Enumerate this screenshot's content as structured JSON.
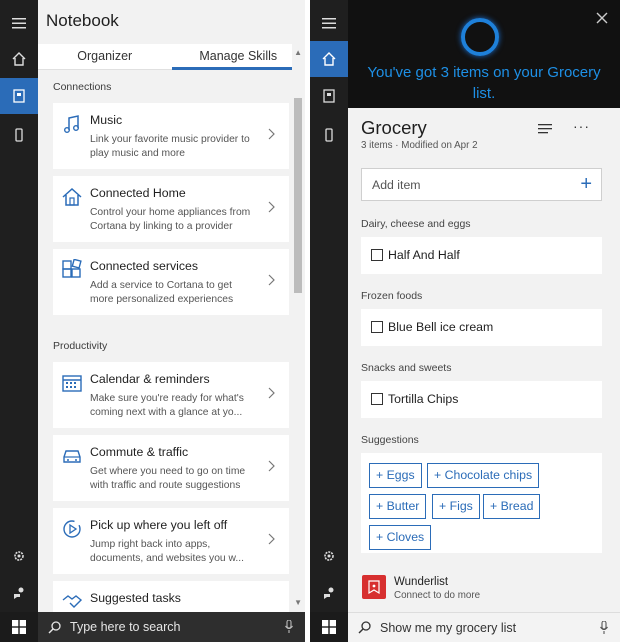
{
  "notebook": {
    "title": "Notebook",
    "tabs": [
      "Organizer",
      "Manage Skills"
    ],
    "sections": {
      "connections": "Connections",
      "productivity": "Productivity"
    },
    "cards": [
      {
        "title": "Music",
        "desc": "Link your favorite music provider to play music and more",
        "icon": "music-icon"
      },
      {
        "title": "Connected Home",
        "desc": "Control your home appliances from Cortana by linking to a provider",
        "icon": "home-icon"
      },
      {
        "title": "Connected services",
        "desc": "Add a service to Cortana to get more personalized experiences",
        "icon": "services-icon"
      },
      {
        "title": "Calendar & reminders",
        "desc": "Make sure you're ready for what's coming next with a glance at yo...",
        "icon": "calendar-icon"
      },
      {
        "title": "Commute & traffic",
        "desc": "Get where you need to go on time with traffic and route suggestions",
        "icon": "car-icon"
      },
      {
        "title": "Pick up where you left off",
        "desc": "Jump right back into apps, documents, and websites you w...",
        "icon": "resume-icon"
      },
      {
        "title": "Suggested tasks",
        "desc": "",
        "icon": "handshake-icon"
      }
    ],
    "search_placeholder": "Type here to search"
  },
  "cortana": {
    "message": "You've got 3 items on your Grocery list.",
    "list_title": "Grocery",
    "list_subtitle": "3 items · Modified on Apr 2",
    "add_placeholder": "Add item",
    "categories": [
      {
        "name": "Dairy, cheese and eggs",
        "item": "Half And Half"
      },
      {
        "name": "Frozen foods",
        "item": "Blue Bell ice cream"
      },
      {
        "name": "Snacks and sweets",
        "item": "Tortilla Chips"
      }
    ],
    "suggestions_label": "Suggestions",
    "suggestions": [
      "+ Eggs",
      "+ Chocolate chips",
      "+ Butter",
      "+ Figs",
      "+ Bread",
      "+ Cloves"
    ],
    "provider": {
      "name": "Wunderlist",
      "subtitle": "Connect to do more"
    },
    "search_placeholder": "Show me my grocery list"
  },
  "colors": {
    "accent": "#2b6cb8",
    "rail": "#1f1f1f",
    "panel": "#f2f2f2",
    "provider": "#d72f2f"
  }
}
